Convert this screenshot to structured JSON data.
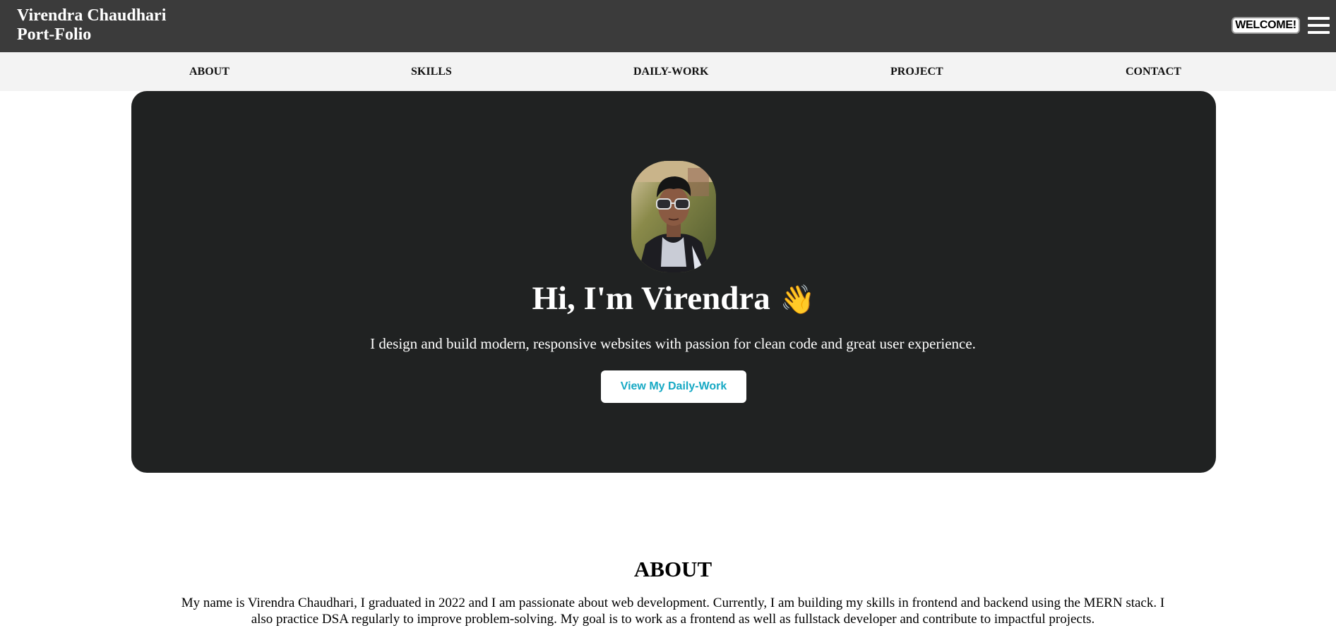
{
  "header": {
    "brand_line1": "Virendra Chaudhari",
    "brand_line2": "Port-Folio",
    "welcome_badge": "WELCOME!",
    "menu_icon": "hamburger-menu-icon"
  },
  "nav": {
    "items": [
      "ABOUT",
      "SKILLS",
      "DAILY-WORK",
      "PROJECT",
      "CONTACT"
    ]
  },
  "hero": {
    "avatar_alt": "profile-photo",
    "title": "Hi, I'm Virendra",
    "wave_emoji": "👋",
    "subtitle": "I design and build modern, responsive websites with passion for clean code and great user experience.",
    "cta_label": "View My Daily-Work"
  },
  "about": {
    "title": "ABOUT",
    "text": "My name is Virendra Chaudhari, I graduated in 2022 and I am passionate about web development. Currently, I am building my skills in frontend and backend using the MERN stack. I also practice DSA regularly to improve problem-solving. My goal is to work as a frontend as well as fullstack developer and contribute to impactful projects."
  },
  "colors": {
    "topbar": "#3b3b3b",
    "navbar": "#f3f3f3",
    "hero_bg": "#202222",
    "cta_text": "#17a9c4"
  }
}
